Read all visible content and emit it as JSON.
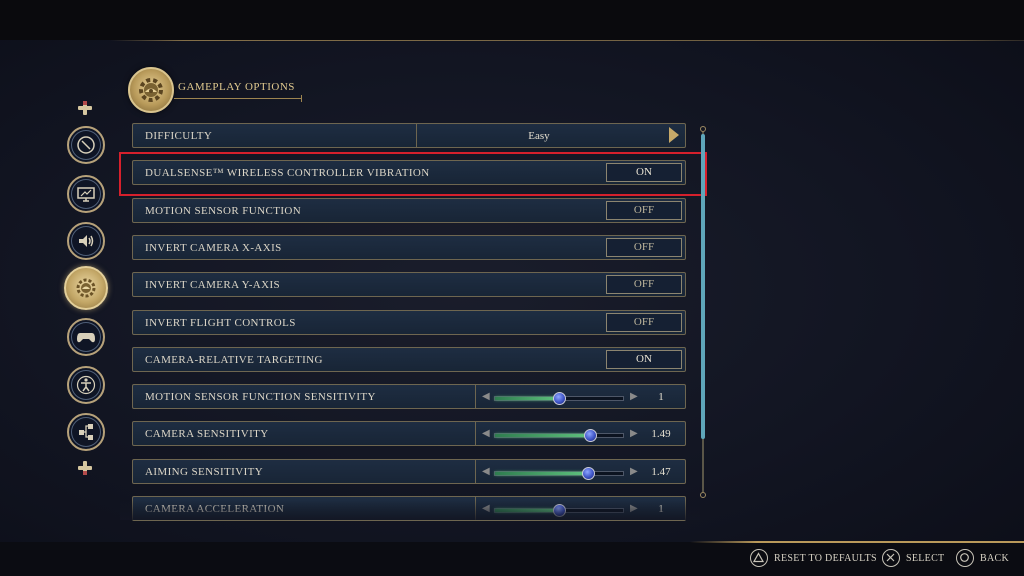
{
  "header": {
    "title": "GAMEPLAY OPTIONS",
    "icon": "gear-icon"
  },
  "side_nav": {
    "items": [
      {
        "icon": "compass-icon"
      },
      {
        "icon": "display-icon"
      },
      {
        "icon": "audio-icon"
      },
      {
        "icon": "gear-icon",
        "active": true
      },
      {
        "icon": "controller-icon"
      },
      {
        "icon": "accessibility-icon"
      },
      {
        "icon": "network-icon"
      }
    ]
  },
  "settings": {
    "rows": [
      {
        "label": "DIFFICULTY",
        "type": "select",
        "value": "Easy"
      },
      {
        "label": "DUALSENSE™ WIRELESS CONTROLLER VIBRATION",
        "type": "toggle",
        "value": "ON"
      },
      {
        "label": "MOTION SENSOR FUNCTION",
        "type": "toggle",
        "value": "OFF"
      },
      {
        "label": "INVERT CAMERA X-AXIS",
        "type": "toggle",
        "value": "OFF"
      },
      {
        "label": "INVERT CAMERA Y-AXIS",
        "type": "toggle",
        "value": "OFF"
      },
      {
        "label": "INVERT FLIGHT CONTROLS",
        "type": "toggle",
        "value": "OFF"
      },
      {
        "label": "CAMERA-RELATIVE TARGETING",
        "type": "toggle",
        "value": "ON"
      },
      {
        "label": "MOTION SENSOR FUNCTION SENSITIVITY",
        "type": "slider",
        "value": "1",
        "level": 0.5
      },
      {
        "label": "CAMERA SENSITIVITY",
        "type": "slider",
        "value": "1.49",
        "level": 0.74
      },
      {
        "label": "AIMING SENSITIVITY",
        "type": "slider",
        "value": "1.47",
        "level": 0.73
      },
      {
        "label": "CAMERA ACCELERATION",
        "type": "slider",
        "value": "1",
        "level": 0.5
      }
    ],
    "highlighted_row": 1
  },
  "footer": {
    "reset": "RESET TO DEFAULTS",
    "select": "SELECT",
    "back": "BACK"
  },
  "colors": {
    "accent_gold": "#c6a969",
    "highlight_red": "#d6202c",
    "slider_green": "#5fc27e",
    "knob_blue": "#3f55c7"
  }
}
